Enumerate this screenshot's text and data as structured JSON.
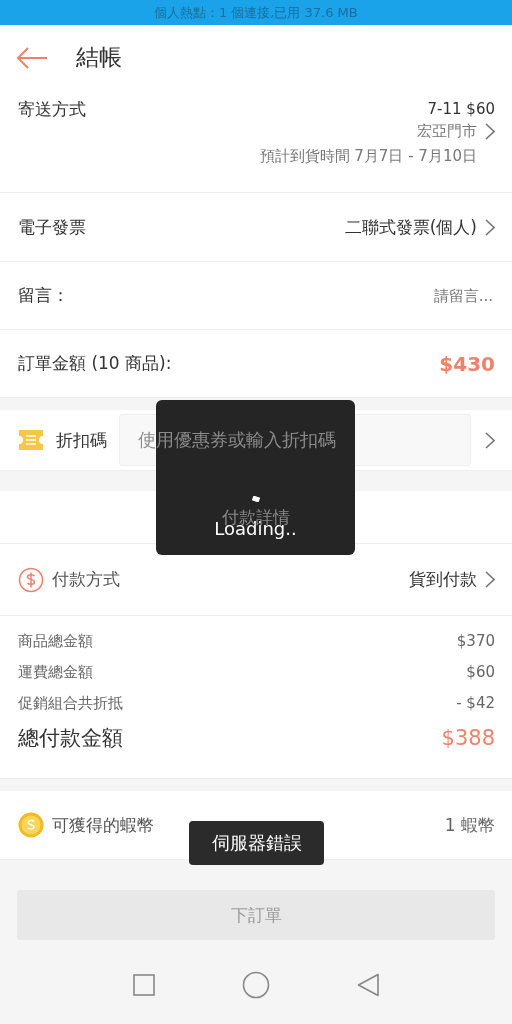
{
  "status_bar": {
    "text": "個人熱點 : 1 個連接,已用 37.6 MB"
  },
  "header": {
    "title": "結帳"
  },
  "shipping": {
    "label": "寄送方式",
    "price": "7-11 $60",
    "store": "宏亞門市",
    "eta": "預計到貨時間 7月7日 - 7月10日"
  },
  "invoice": {
    "label": "電子發票",
    "value": "二聯式發票(個人)"
  },
  "message": {
    "label": "留言：",
    "placeholder": "請留言..."
  },
  "order_total": {
    "label": "訂單金額 (10 商品):",
    "value": "$430"
  },
  "coupon": {
    "label": "折扣碼",
    "placeholder": "使用優惠券或輸入折扣碼"
  },
  "payment_details": {
    "title": "付款詳情"
  },
  "payment_method": {
    "label": "付款方式",
    "value": "貨到付款"
  },
  "breakdown": [
    {
      "label": "商品總金額",
      "value": "$370"
    },
    {
      "label": "運費總金額",
      "value": "$60"
    },
    {
      "label": "促銷組合共折抵",
      "value": "- $42"
    }
  ],
  "grand_total": {
    "label": "總付款金額",
    "value": "$388"
  },
  "coins": {
    "label": "可獲得的蝦幣",
    "value": "1 蝦幣"
  },
  "place_order": {
    "label": "下訂單",
    "disabled": true
  },
  "loading": {
    "text": "Loading.."
  },
  "toast": {
    "text": "伺服器錯誤"
  }
}
